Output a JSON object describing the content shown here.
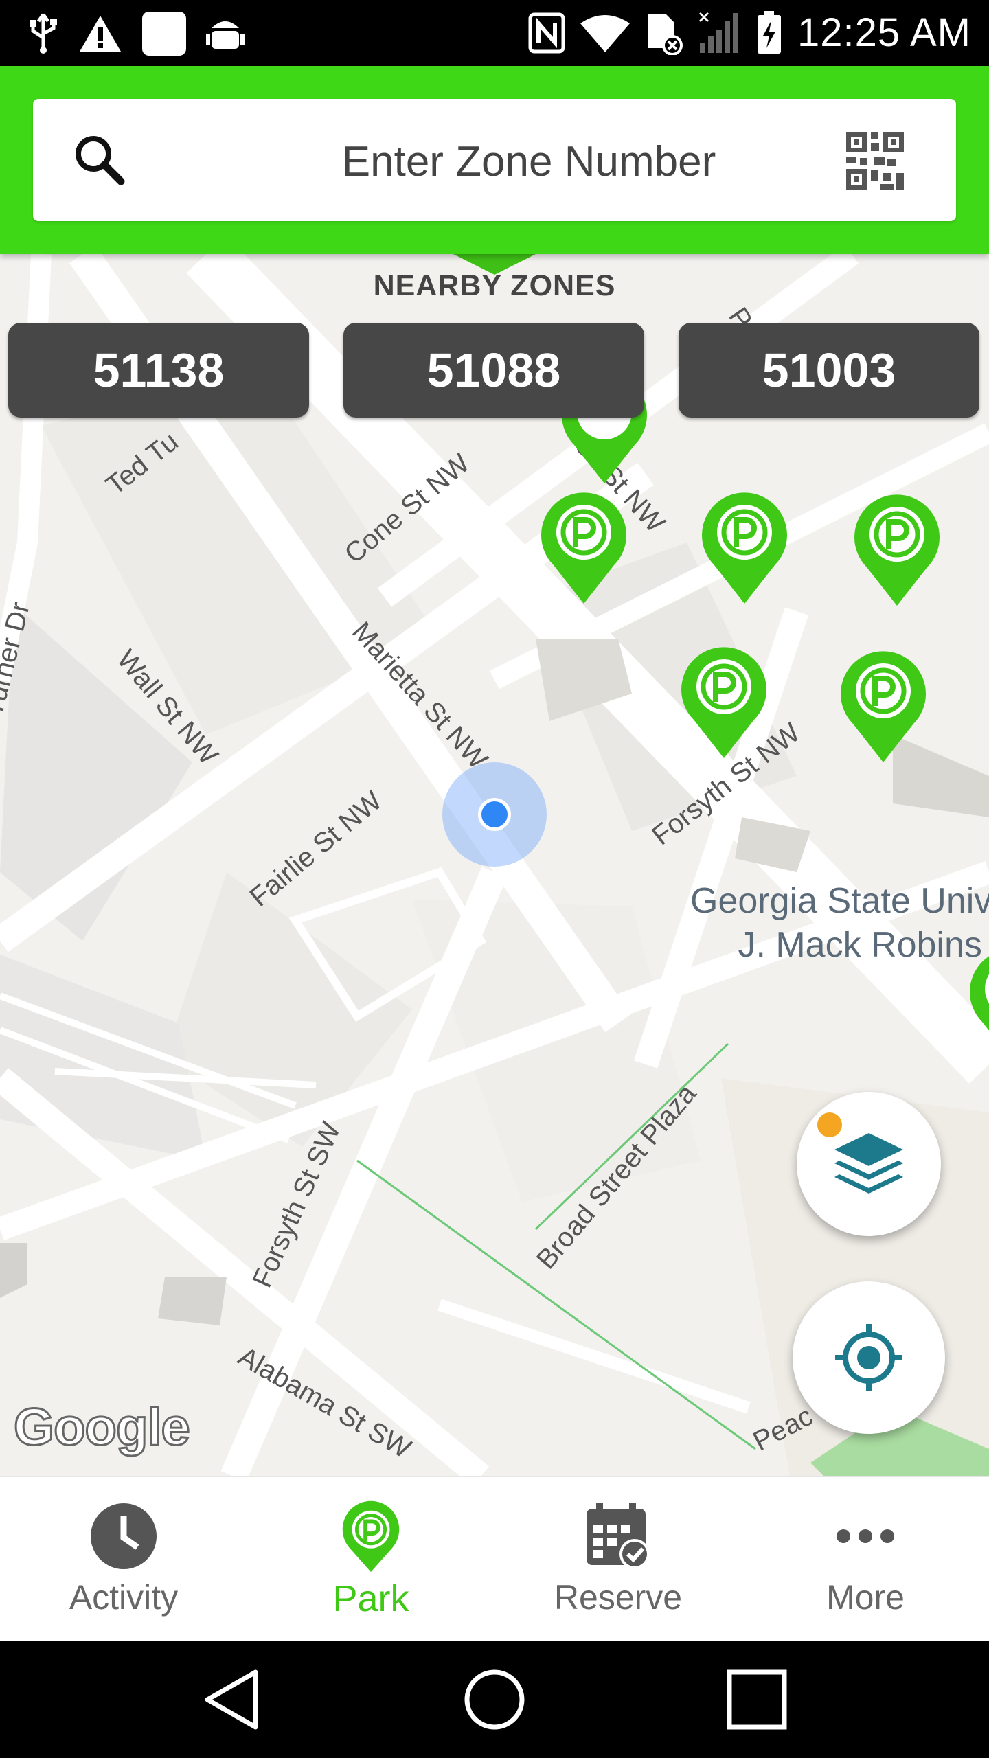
{
  "status_bar": {
    "time": "12:25 AM",
    "icons_left": [
      "usb-icon",
      "warning-icon",
      "notification-square-icon",
      "android-debug-icon"
    ],
    "icons_right": [
      "nfc-icon",
      "wifi-icon",
      "sim-off-icon",
      "signal-icon",
      "battery-charging-icon"
    ]
  },
  "search": {
    "placeholder": "Enter Zone Number"
  },
  "nearby": {
    "title": "NEARBY ZONES",
    "zones": [
      "51138",
      "51088",
      "51003"
    ]
  },
  "map": {
    "streets": [
      "Ted Tu",
      "Cone St NW",
      "Marietta St NW",
      "Wall St NW",
      "Turner Dr",
      "Fairlie St NW",
      "Forsyth St NW",
      "Forsyth St SW",
      "Broad Street Plaza",
      "Alabama St SW",
      "Peac",
      "on St NW",
      "Po"
    ],
    "poi": {
      "line1": "Georgia State Univ",
      "line2": "J. Mack Robins"
    },
    "attribution": "Google"
  },
  "bottom_nav": {
    "items": [
      {
        "label": "Activity",
        "icon": "clock-icon"
      },
      {
        "label": "Park",
        "icon": "park-pin-icon"
      },
      {
        "label": "Reserve",
        "icon": "calendar-check-icon"
      },
      {
        "label": "More",
        "icon": "more-dots-icon"
      }
    ],
    "active": "Park"
  },
  "colors": {
    "brand_green": "#3fd816",
    "zone_button": "#474747",
    "user_location": "#2f86f5",
    "layer_badge": "#f4a623",
    "map_bg": "#f2f0ec"
  }
}
